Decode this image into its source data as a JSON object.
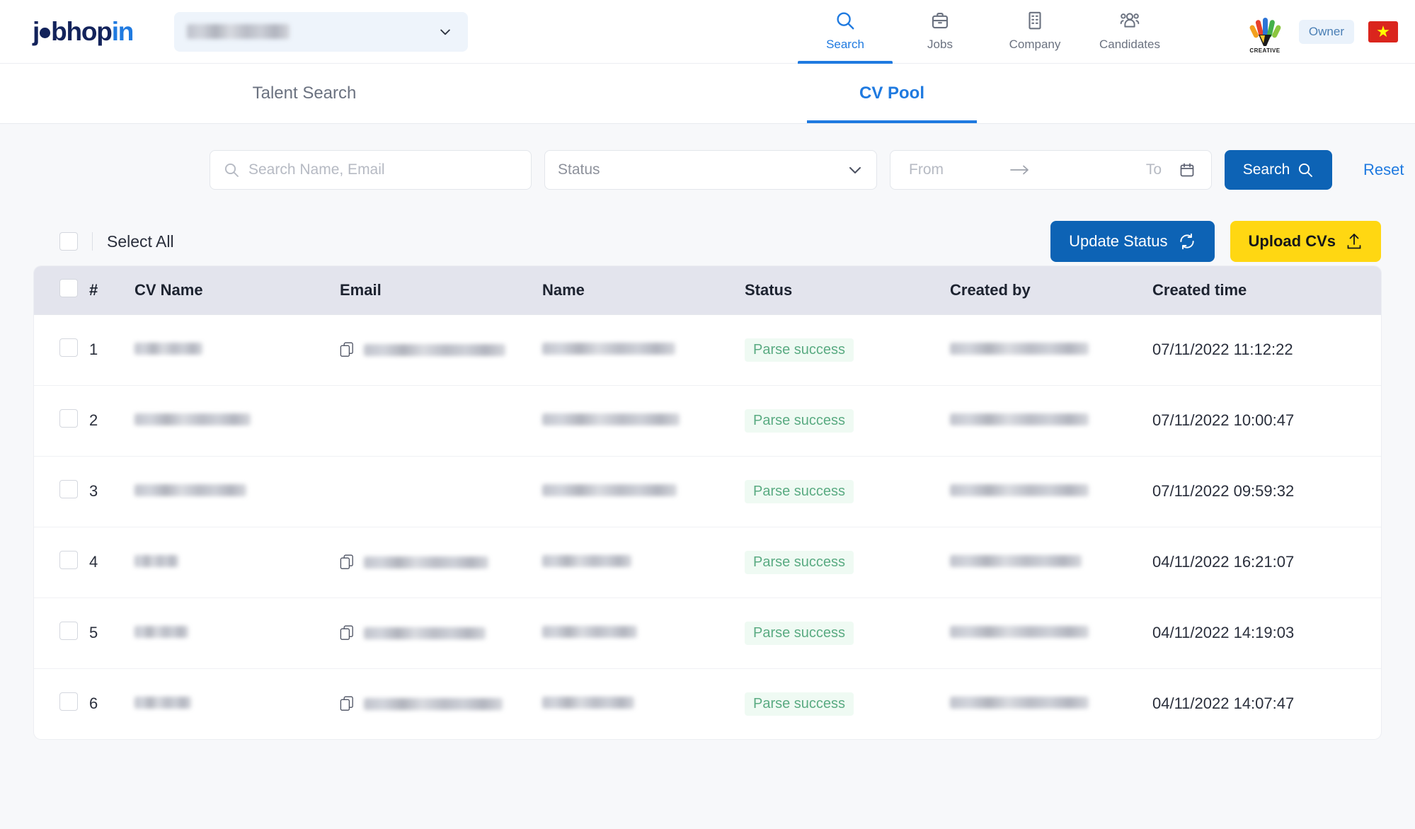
{
  "brand": {
    "logo_text_1": "j",
    "logo_text_2": "bhop",
    "logo_text_3": "in"
  },
  "header": {
    "org_selector": {
      "value": "",
      "redacted": true,
      "chevron_icon": "chevron-down-icon"
    },
    "nav": [
      {
        "label": "Search",
        "icon": "search-icon",
        "active": true
      },
      {
        "label": "Jobs",
        "icon": "briefcase-icon",
        "active": false
      },
      {
        "label": "Company",
        "icon": "building-icon",
        "active": false
      },
      {
        "label": "Candidates",
        "icon": "people-icon",
        "active": false
      }
    ],
    "creative_logo_label": "CREATIVE",
    "role_badge": "Owner",
    "language_flag": "vietnam-flag",
    "flag_star": "★"
  },
  "subtabs": [
    {
      "label": "Talent Search",
      "active": false
    },
    {
      "label": "CV Pool",
      "active": true
    }
  ],
  "filters": {
    "search_placeholder": "Search Name, Email",
    "search_value": "",
    "search_icon": "search-icon",
    "status_label": "Status",
    "status_value": "",
    "status_chevron": "chevron-down-icon",
    "date_from_placeholder": "From",
    "date_from_value": "",
    "date_arrow": "→",
    "date_to_placeholder": "To",
    "date_to_value": "",
    "calendar_icon": "calendar-icon",
    "search_button": "Search",
    "reset_link": "Reset"
  },
  "toolbar": {
    "select_all_label": "Select All",
    "update_status_label": "Update Status",
    "update_status_icon": "refresh-icon",
    "upload_cvs_label": "Upload CVs",
    "upload_cvs_icon": "upload-icon"
  },
  "table": {
    "columns": [
      "",
      "#",
      "CV Name",
      "Email",
      "Name",
      "Status",
      "Created by",
      "Created time"
    ],
    "rows": [
      {
        "num": "1",
        "cv_name": "",
        "cv_w": 96,
        "email": "",
        "email_w": 200,
        "has_email": true,
        "name": "",
        "name_w": 188,
        "status": "Parse success",
        "created_by": "",
        "by_w": 196,
        "created_time": "07/11/2022 11:12:22"
      },
      {
        "num": "2",
        "cv_name": "",
        "cv_w": 164,
        "email": "",
        "email_w": 0,
        "has_email": false,
        "name": "",
        "name_w": 194,
        "status": "Parse success",
        "created_by": "",
        "by_w": 196,
        "created_time": "07/11/2022 10:00:47"
      },
      {
        "num": "3",
        "cv_name": "",
        "cv_w": 158,
        "email": "",
        "email_w": 0,
        "has_email": false,
        "name": "",
        "name_w": 190,
        "status": "Parse success",
        "created_by": "",
        "by_w": 196,
        "created_time": "07/11/2022 09:59:32"
      },
      {
        "num": "4",
        "cv_name": "",
        "cv_w": 62,
        "email": "",
        "email_w": 176,
        "has_email": true,
        "name": "",
        "name_w": 126,
        "status": "Parse success",
        "created_by": "",
        "by_w": 186,
        "created_time": "04/11/2022 16:21:07"
      },
      {
        "num": "5",
        "cv_name": "",
        "cv_w": 76,
        "email": "",
        "email_w": 172,
        "has_email": true,
        "name": "",
        "name_w": 134,
        "status": "Parse success",
        "created_by": "",
        "by_w": 196,
        "created_time": "04/11/2022 14:19:03"
      },
      {
        "num": "6",
        "cv_name": "",
        "cv_w": 80,
        "email": "",
        "email_w": 196,
        "has_email": true,
        "name": "",
        "name_w": 130,
        "status": "Parse success",
        "created_by": "",
        "by_w": 196,
        "created_time": "04/11/2022 14:07:47"
      }
    ]
  },
  "colors": {
    "brand_navy": "#13235b",
    "brand_blue": "#1f7ae0",
    "button_blue": "#0d63b5",
    "upload_yellow": "#ffd712",
    "status_green": "#5aab82",
    "status_green_bg": "#effaf3",
    "page_bg": "#f7f8fa",
    "table_header_bg": "#e3e4ed",
    "flag_red": "#da251d",
    "flag_yellow": "#ffff00"
  }
}
